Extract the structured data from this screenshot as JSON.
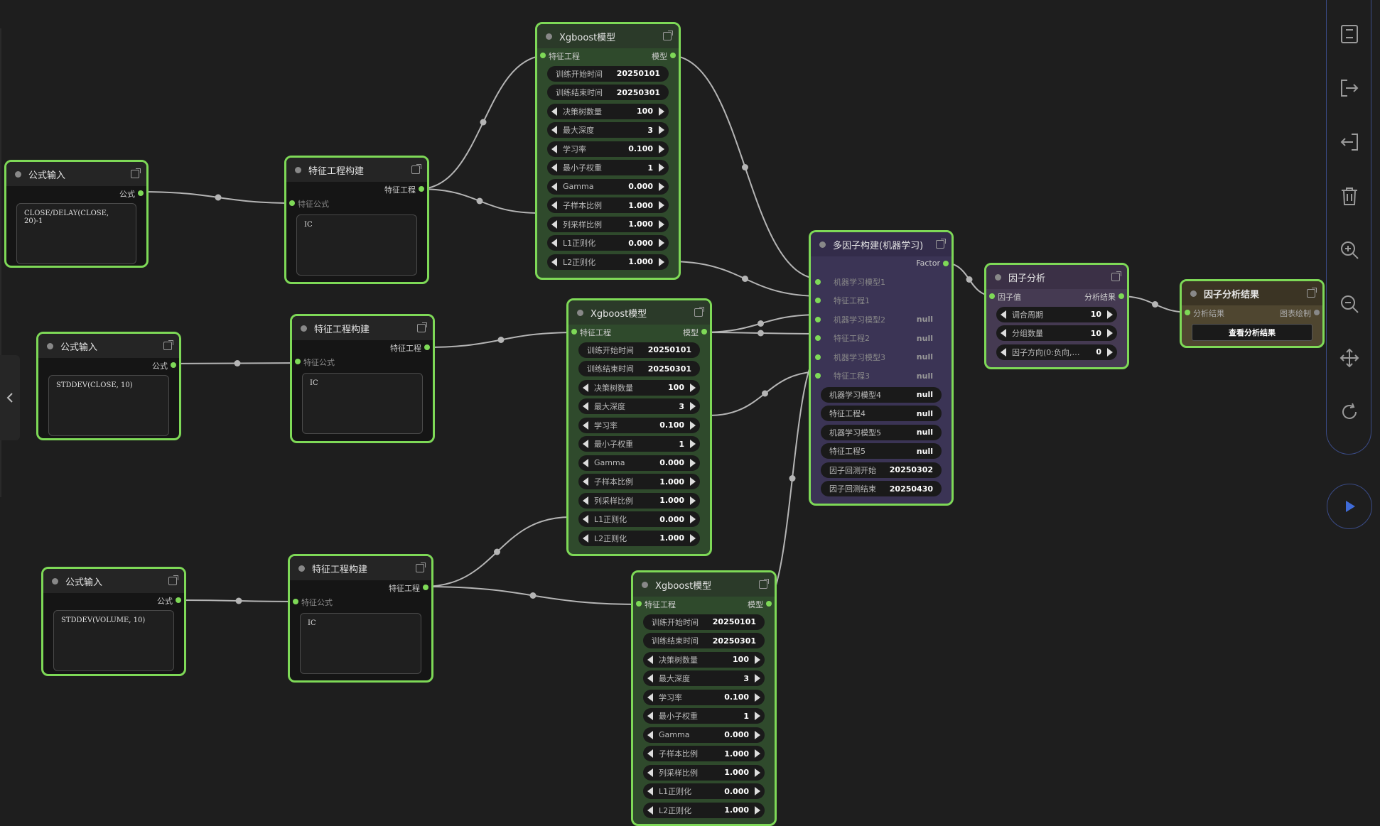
{
  "formula_nodes": [
    {
      "title": "公式输入",
      "output": "公式",
      "formula": "CLOSE/DELAY(CLOSE, 20)-1"
    },
    {
      "title": "公式输入",
      "output": "公式",
      "formula": "STDDEV(CLOSE, 10)"
    },
    {
      "title": "公式输入",
      "output": "公式",
      "formula": "STDDEV(VOLUME, 10)"
    }
  ],
  "feature_nodes": [
    {
      "title": "特征工程构建",
      "output": "特征工程",
      "input": "特征公式",
      "text": "IC"
    },
    {
      "title": "特征工程构建",
      "output": "特征工程",
      "input": "特征公式",
      "text": "IC"
    },
    {
      "title": "特征工程构建",
      "output": "特征工程",
      "input": "特征公式",
      "text": "IC"
    }
  ],
  "xgb_nodes": [
    {
      "title": "Xgboost模型",
      "input": "特征工程",
      "output": "模型",
      "dates": [
        {
          "label": "训练开始时间",
          "value": "20250101"
        },
        {
          "label": "训练结束时间",
          "value": "20250301"
        }
      ],
      "params": [
        {
          "label": "决策树数量",
          "value": "100"
        },
        {
          "label": "最大深度",
          "value": "3"
        },
        {
          "label": "学习率",
          "value": "0.100"
        },
        {
          "label": "最小子权重",
          "value": "1"
        },
        {
          "label": "Gamma",
          "value": "0.000"
        },
        {
          "label": "子样本比例",
          "value": "1.000"
        },
        {
          "label": "列采样比例",
          "value": "1.000"
        },
        {
          "label": "L1正则化",
          "value": "0.000"
        },
        {
          "label": "L2正则化",
          "value": "1.000"
        }
      ]
    },
    {
      "title": "Xgboost模型",
      "input": "特征工程",
      "output": "模型",
      "dates": [
        {
          "label": "训练开始时间",
          "value": "20250101"
        },
        {
          "label": "训练结束时间",
          "value": "20250301"
        }
      ],
      "params": [
        {
          "label": "决策树数量",
          "value": "100"
        },
        {
          "label": "最大深度",
          "value": "3"
        },
        {
          "label": "学习率",
          "value": "0.100"
        },
        {
          "label": "最小子权重",
          "value": "1"
        },
        {
          "label": "Gamma",
          "value": "0.000"
        },
        {
          "label": "子样本比例",
          "value": "1.000"
        },
        {
          "label": "列采样比例",
          "value": "1.000"
        },
        {
          "label": "L1正则化",
          "value": "0.000"
        },
        {
          "label": "L2正则化",
          "value": "1.000"
        }
      ]
    },
    {
      "title": "Xgboost模型",
      "input": "特征工程",
      "output": "模型",
      "dates": [
        {
          "label": "训练开始时间",
          "value": "20250101"
        },
        {
          "label": "训练结束时间",
          "value": "20250301"
        }
      ],
      "params": [
        {
          "label": "决策树数量",
          "value": "100"
        },
        {
          "label": "最大深度",
          "value": "3"
        },
        {
          "label": "学习率",
          "value": "0.100"
        },
        {
          "label": "最小子权重",
          "value": "1"
        },
        {
          "label": "Gamma",
          "value": "0.000"
        },
        {
          "label": "子样本比例",
          "value": "1.000"
        },
        {
          "label": "列采样比例",
          "value": "1.000"
        },
        {
          "label": "L1正则化",
          "value": "0.000"
        },
        {
          "label": "L2正则化",
          "value": "1.000"
        }
      ]
    }
  ],
  "multifactor": {
    "title": "多因子构建(机器学习)",
    "output": "Factor",
    "connected": [
      {
        "label": "机器学习模型1",
        "value": ""
      },
      {
        "label": "特征工程1",
        "value": ""
      },
      {
        "label": "机器学习模型2",
        "value": "null"
      },
      {
        "label": "特征工程2",
        "value": "null"
      },
      {
        "label": "机器学习模型3",
        "value": "null"
      },
      {
        "label": "特征工程3",
        "value": "null"
      }
    ],
    "widgets": [
      {
        "label": "机器学习模型4",
        "value": "null"
      },
      {
        "label": "特征工程4",
        "value": "null"
      },
      {
        "label": "机器学习模型5",
        "value": "null"
      },
      {
        "label": "特征工程5",
        "value": "null"
      },
      {
        "label": "因子回测开始",
        "value": "20250302"
      },
      {
        "label": "因子回测结束",
        "value": "20250430"
      }
    ]
  },
  "factor_analysis": {
    "title": "因子分析",
    "input": "因子值",
    "output": "分析结果",
    "params": [
      {
        "label": "调合周期",
        "value": "10"
      },
      {
        "label": "分组数量",
        "value": "10"
      },
      {
        "label": "因子方向(0:负向,…",
        "value": "0"
      }
    ]
  },
  "result_node": {
    "title": "因子分析结果",
    "input": "分析结果",
    "output": "图表绘制",
    "button": "查看分析结果"
  },
  "toolbar": [
    "save-icon",
    "export-icon",
    "import-icon",
    "trash-icon",
    "zoom-in-icon",
    "zoom-out-icon",
    "move-icon",
    "refresh-icon"
  ],
  "colors": {
    "node_border": "#7ed957",
    "canvas": "#1e1e1e",
    "toolbar_border": "#3a4b86",
    "link": "#b5b5b5"
  }
}
